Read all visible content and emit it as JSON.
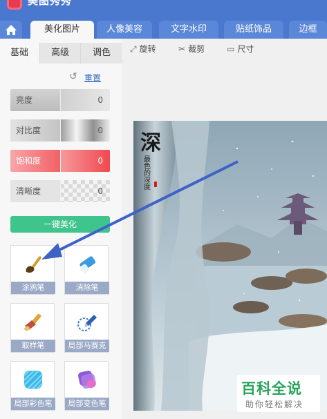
{
  "app": {
    "title": "美图秀秀"
  },
  "tabs": [
    {
      "label": "美化图片",
      "active": true
    },
    {
      "label": "人像美容",
      "active": false
    },
    {
      "label": "文字水印",
      "active": false
    },
    {
      "label": "贴纸饰品",
      "active": false
    },
    {
      "label": "边框",
      "active": false
    }
  ],
  "subtabs": [
    {
      "label": "基础",
      "active": true
    },
    {
      "label": "高级",
      "active": false
    },
    {
      "label": "调色",
      "active": false
    }
  ],
  "reset_label": "重置",
  "sliders": [
    {
      "label": "亮度",
      "value": "0",
      "color": "#c8c8c8"
    },
    {
      "label": "对比度",
      "value": "0",
      "color": "#bfbfbf"
    },
    {
      "label": "饱和度",
      "value": "0",
      "color": "#f26166"
    },
    {
      "label": "清晰度",
      "value": "0",
      "color": "#d4d4d4"
    }
  ],
  "one_key_label": "一键美化",
  "tools": [
    {
      "label": "涂鸦笔",
      "icon": "paintbrush-icon"
    },
    {
      "label": "消除笔",
      "icon": "eraser-icon"
    },
    {
      "label": "取样笔",
      "icon": "sample-brush-icon"
    },
    {
      "label": "局部马赛克",
      "icon": "mosaic-pen-icon"
    },
    {
      "label": "局部彩色笔",
      "icon": "color-pen-icon"
    },
    {
      "label": "局部变色笔",
      "icon": "recolor-pen-icon"
    }
  ],
  "toolbar": {
    "rotate": "旋转",
    "crop": "裁剪",
    "size": "尺寸"
  },
  "image_text": {
    "title": "深",
    "subtitle": "最色的深度"
  },
  "watermark": {
    "main": "百科全说",
    "sub": "助你轻松解决"
  },
  "colors": {
    "accent": "#4a78cf",
    "green": "#3ec48c",
    "arrow": "#3d62c8"
  }
}
